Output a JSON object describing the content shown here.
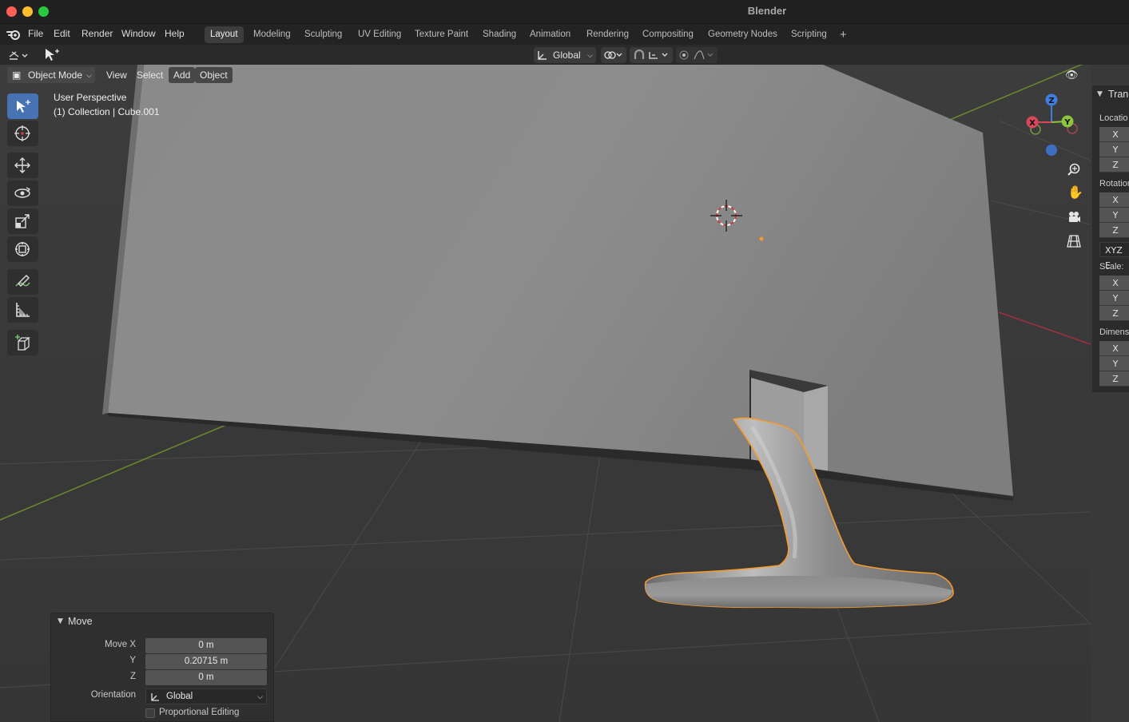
{
  "window": {
    "title": "Blender"
  },
  "menu": {
    "items": [
      "File",
      "Edit",
      "Render",
      "Window",
      "Help"
    ]
  },
  "workspaces": {
    "tabs": [
      "Layout",
      "Modeling",
      "Sculpting",
      "UV Editing",
      "Texture Paint",
      "Shading",
      "Animation",
      "Rendering",
      "Compositing",
      "Geometry Nodes",
      "Scripting"
    ],
    "active": "Layout"
  },
  "header": {
    "orientation": "Global"
  },
  "viewport": {
    "mode": "Object Mode",
    "menus": [
      "View",
      "Select",
      "Add",
      "Object"
    ],
    "perspective": "User Perspective",
    "collection": "(1) Collection | Cube.001"
  },
  "gizmo": {
    "x": "X",
    "y": "Y",
    "z": "Z"
  },
  "npanel": {
    "header": "Tran",
    "location": "Locatio",
    "rotation": "Rotation",
    "rotation_mode": "XYZ E",
    "scale": "Scale:",
    "dimensions": "Dimens",
    "axes": [
      "X",
      "Y",
      "Z"
    ]
  },
  "operator": {
    "title": "Move",
    "move_x_label": "Move X",
    "move_x": "0 m",
    "y_label": "Y",
    "y": "0.20715 m",
    "z_label": "Z",
    "z": "0 m",
    "orientation_label": "Orientation",
    "orientation": "Global",
    "proportional": "Proportional Editing"
  },
  "colors": {
    "accent": "#4772b3",
    "selection": "#f59b30",
    "x_axis": "#d9485a",
    "y_axis": "#8cc63f",
    "z_axis": "#3d7ee0"
  }
}
